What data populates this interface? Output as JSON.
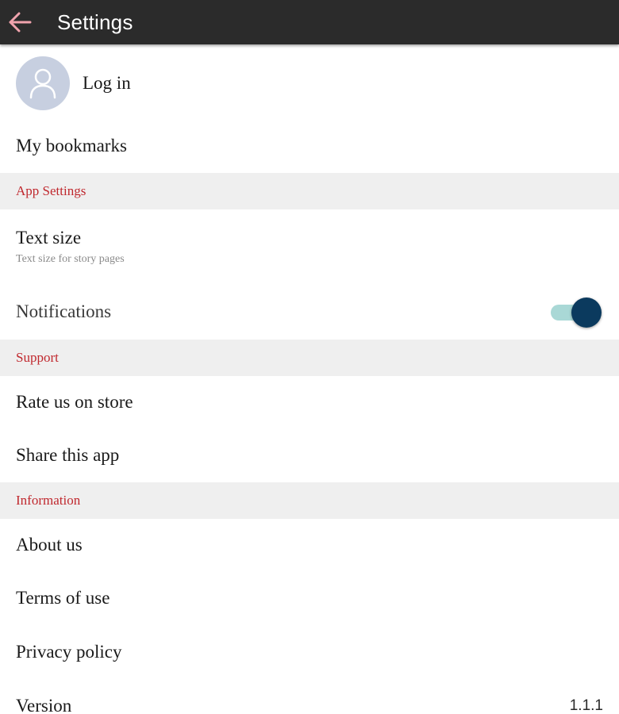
{
  "app_bar": {
    "title": "Settings",
    "back_icon": "arrow-left-icon",
    "back_icon_color": "#f0a3ad",
    "background": "#2b2b2b"
  },
  "account": {
    "avatar_icon": "user-icon",
    "login_label": "Log in"
  },
  "bookmarks_label": "My bookmarks",
  "sections": {
    "app_settings": "App Settings",
    "support": "Support",
    "information": "Information",
    "header_color": "#c0282e"
  },
  "app_settings": {
    "text_size_label": "Text size",
    "text_size_subtitle": "Text size for story pages",
    "notifications_label": "Notifications",
    "notifications_enabled": true
  },
  "support": {
    "rate_label": "Rate us on store",
    "share_label": "Share this app"
  },
  "information": {
    "about_label": "About us",
    "terms_label": "Terms of use",
    "privacy_label": "Privacy policy",
    "version_label": "Version",
    "version_value": "1.1.1"
  }
}
